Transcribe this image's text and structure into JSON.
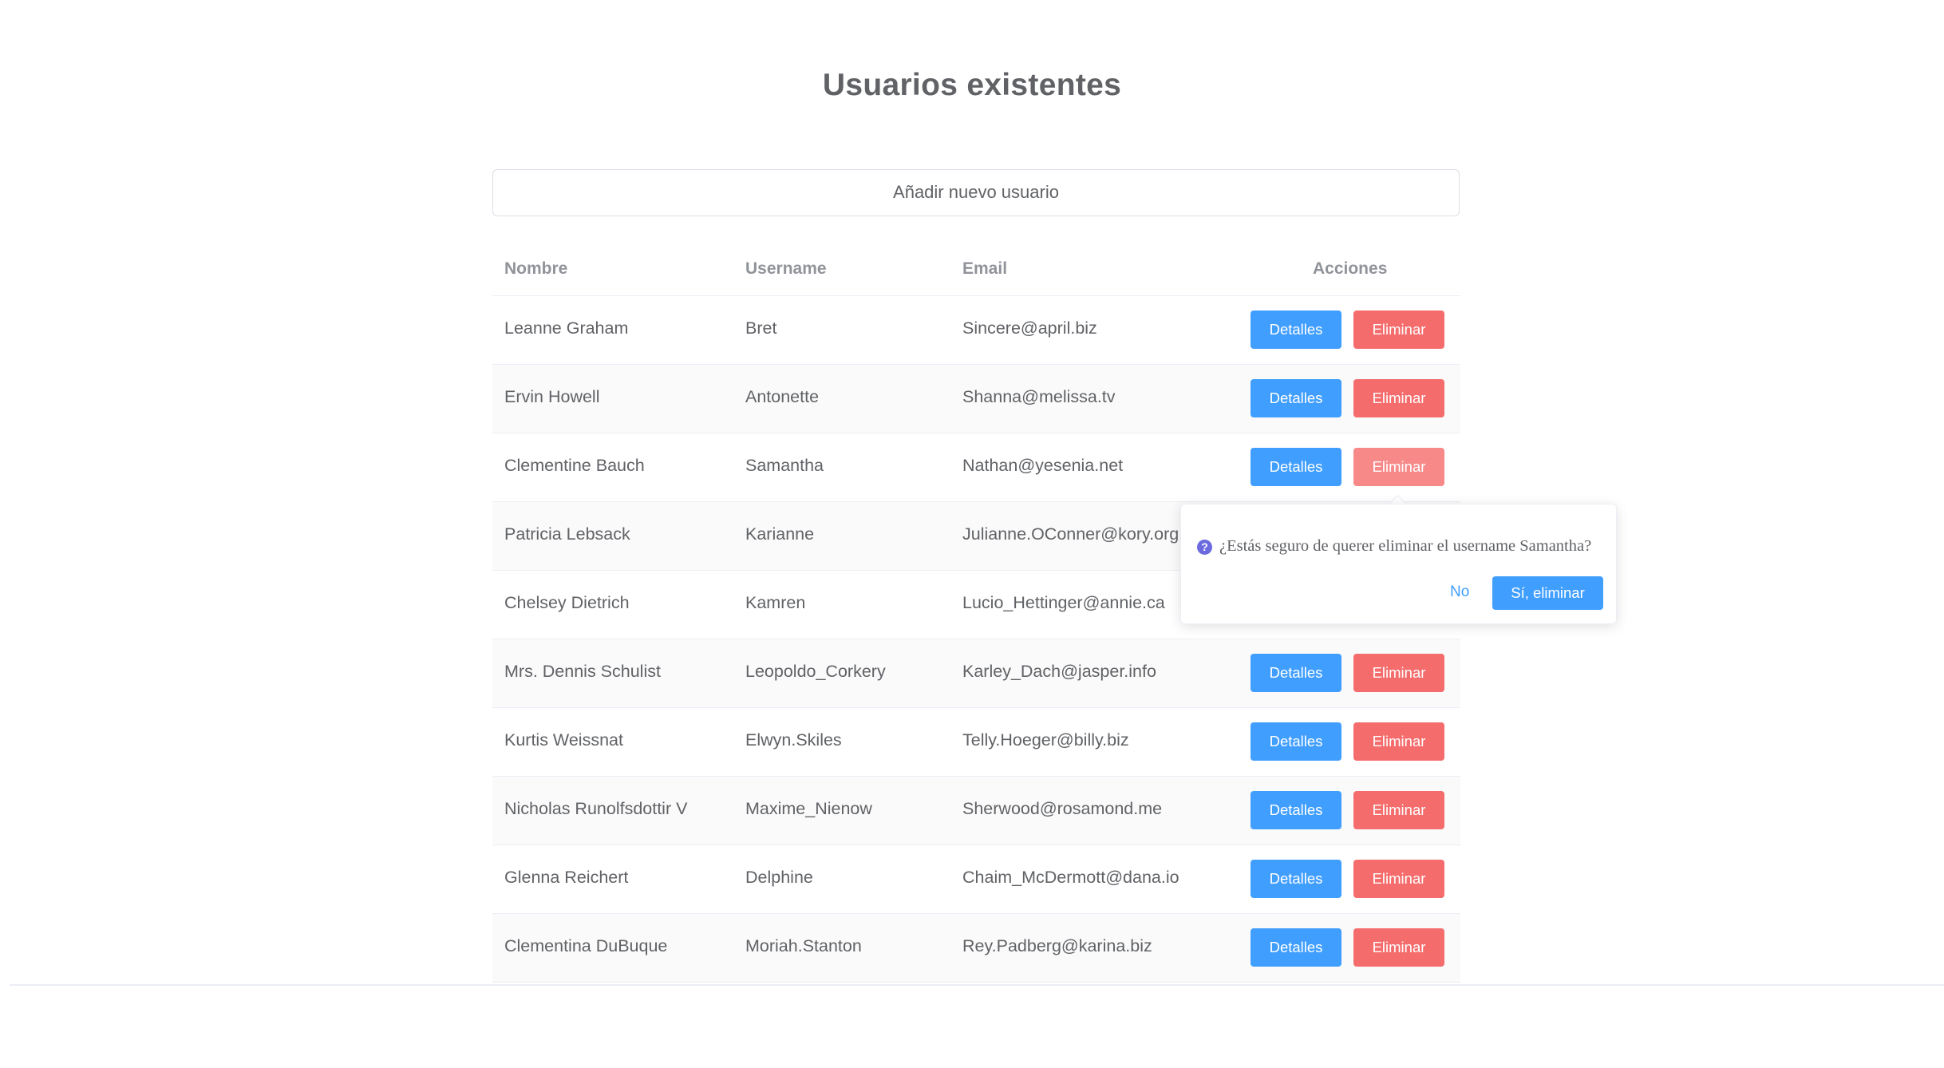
{
  "title": "Usuarios existentes",
  "add_button_label": "Añadir nuevo usuario",
  "table": {
    "headers": {
      "name": "Nombre",
      "username": "Username",
      "email": "Email",
      "actions": "Acciones"
    },
    "detail_label": "Detalles",
    "delete_label": "Eliminar",
    "rows": [
      {
        "name": "Leanne Graham",
        "username": "Bret",
        "email": "Sincere@april.biz"
      },
      {
        "name": "Ervin Howell",
        "username": "Antonette",
        "email": "Shanna@melissa.tv"
      },
      {
        "name": "Clementine Bauch",
        "username": "Samantha",
        "email": "Nathan@yesenia.net"
      },
      {
        "name": "Patricia Lebsack",
        "username": "Karianne",
        "email": "Julianne.OConner@kory.org"
      },
      {
        "name": "Chelsey Dietrich",
        "username": "Kamren",
        "email": "Lucio_Hettinger@annie.ca"
      },
      {
        "name": "Mrs. Dennis Schulist",
        "username": "Leopoldo_Corkery",
        "email": "Karley_Dach@jasper.info"
      },
      {
        "name": "Kurtis Weissnat",
        "username": "Elwyn.Skiles",
        "email": "Telly.Hoeger@billy.biz"
      },
      {
        "name": "Nicholas Runolfsdottir V",
        "username": "Maxime_Nienow",
        "email": "Sherwood@rosamond.me"
      },
      {
        "name": "Glenna Reichert",
        "username": "Delphine",
        "email": "Chaim_McDermott@dana.io"
      },
      {
        "name": "Clementina DuBuque",
        "username": "Moriah.Stanton",
        "email": "Rey.Padberg@karina.biz"
      }
    ]
  },
  "popconfirm": {
    "icon": "question-circle-icon",
    "text": "¿Estás seguro de querer eliminar el username Samantha?",
    "cancel_label": "No",
    "confirm_label": "Sí, eliminar"
  },
  "colors": {
    "primary": "#409eff",
    "danger": "#f56c6c",
    "danger_active": "#f78989",
    "text": "#606266",
    "header_text": "#909399"
  }
}
